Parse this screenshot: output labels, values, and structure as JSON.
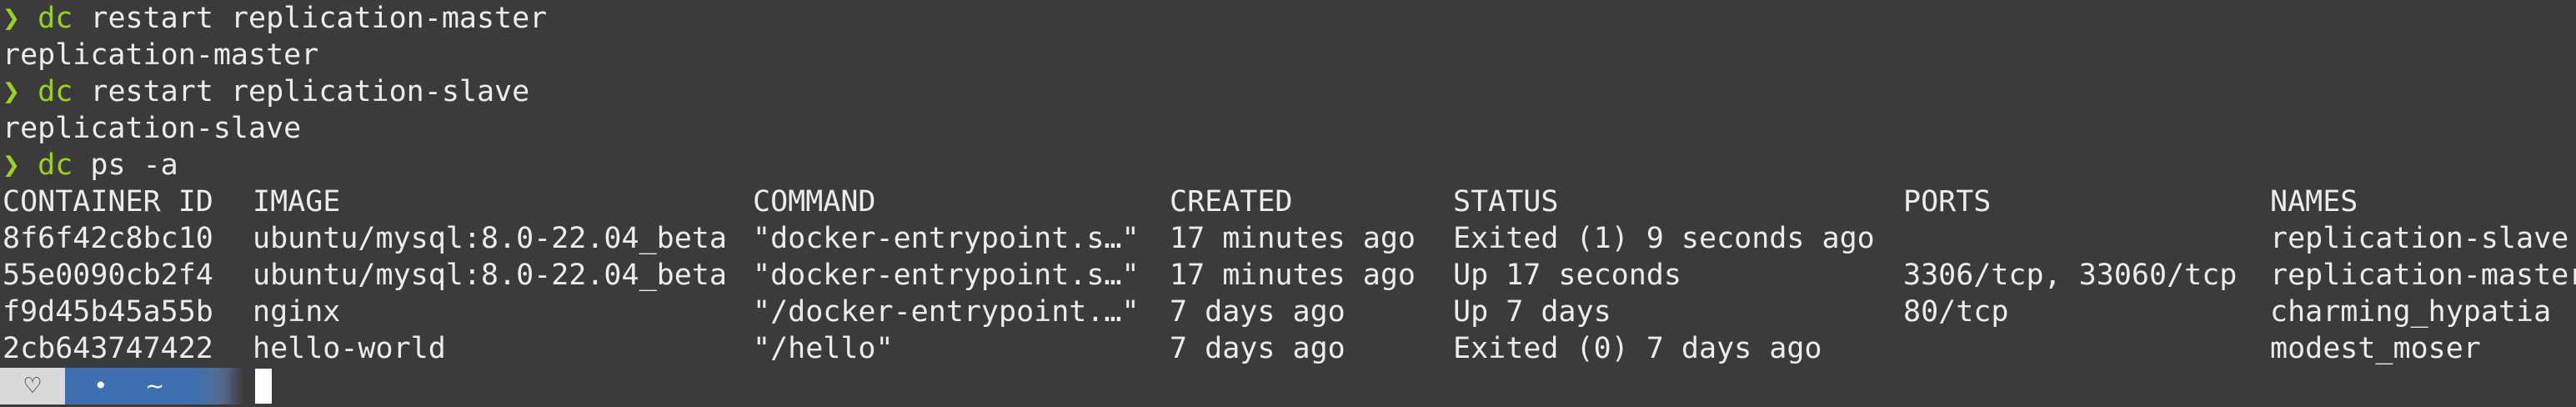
{
  "prompt_symbol": "❯",
  "history": [
    {
      "bin": "dc",
      "args": " restart replication-master",
      "output": "replication-master"
    },
    {
      "bin": "dc",
      "args": " restart replication-slave",
      "output": "replication-slave"
    },
    {
      "bin": "dc",
      "args": " ps -a"
    }
  ],
  "table": {
    "headers": [
      "CONTAINER ID",
      "IMAGE",
      "COMMAND",
      "CREATED",
      "STATUS",
      "PORTS",
      "NAMES"
    ],
    "rows": [
      [
        "8f6f42c8bc10",
        "ubuntu/mysql:8.0-22.04_beta",
        "\"docker-entrypoint.s…\"",
        "17 minutes ago",
        "Exited (1) 9 seconds ago",
        "",
        "replication-slave"
      ],
      [
        "55e0090cb2f4",
        "ubuntu/mysql:8.0-22.04_beta",
        "\"docker-entrypoint.s…\"",
        "17 minutes ago",
        "Up 17 seconds",
        "3306/tcp, 33060/tcp",
        "replication-master"
      ],
      [
        "f9d45b45a55b",
        "nginx",
        "\"/docker-entrypoint.…\"",
        "7 days ago",
        "Up 7 days",
        "80/tcp",
        "charming_hypatia"
      ],
      [
        "2cb643747422",
        "hello-world",
        "\"/hello\"",
        "7 days ago",
        "Exited (0) 7 days ago",
        "",
        "modest_moser"
      ]
    ]
  },
  "statusbar": {
    "heart_glyph": "♡",
    "dot_glyph": "•",
    "dir": "~"
  },
  "colors": {
    "background": "#3b3b3b",
    "prompt_green": "#9bd21f",
    "text": "#ececec",
    "statusbar_blue": "#3d6fb0"
  }
}
